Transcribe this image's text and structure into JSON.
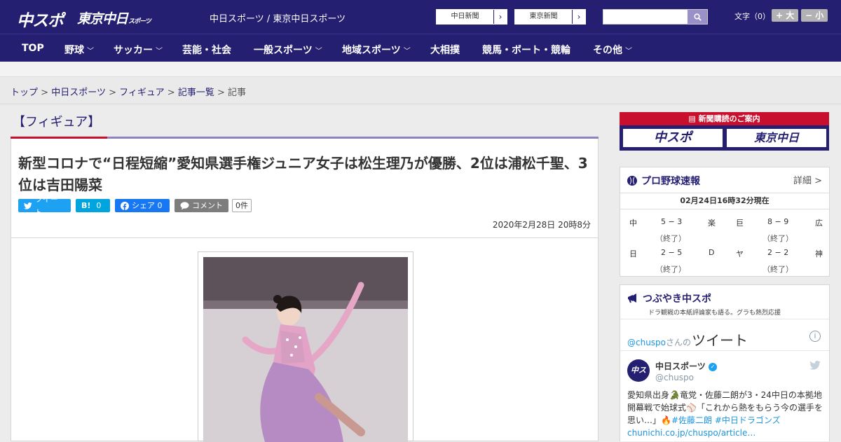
{
  "header": {
    "logo_main": "中スポ",
    "logo_tokyo": "東京中日",
    "logo_tokyo_small": "スポーツ",
    "site_links": "中日スポーツ / 東京中日スポーツ",
    "btn_chunichi": "中日新聞",
    "btn_tokyo": "東京新聞",
    "search_placeholder": "",
    "font_size_label": "文字（0）",
    "font_plus": "+ 大",
    "font_minus": "− 小"
  },
  "nav": {
    "items": [
      {
        "label": "TOP",
        "has_menu": false
      },
      {
        "label": "野球",
        "has_menu": true
      },
      {
        "label": "サッカー",
        "has_menu": true
      },
      {
        "label": "芸能・社会",
        "has_menu": false
      },
      {
        "label": "一般スポーツ",
        "has_menu": true
      },
      {
        "label": "地域スポーツ",
        "has_menu": true
      },
      {
        "label": "大相撲",
        "has_menu": false
      },
      {
        "label": "競馬・ボート・競輪",
        "has_menu": false
      },
      {
        "label": "その他",
        "has_menu": true
      }
    ]
  },
  "breadcrumb": {
    "top": "トップ",
    "site": "中日スポーツ",
    "category": "フィギュア",
    "list": "記事一覧",
    "current": "記事",
    "separator": ">"
  },
  "category_title": "【フィギュア】",
  "article": {
    "headline": "新型コロナで“日程短縮”愛知県選手権ジュニア女子は松生理乃が優勝、2位は浦松千聖、3位は吉田陽菜",
    "share": {
      "tweet": "ツイート",
      "hatena_icon": "B!",
      "hatena_count": "0",
      "facebook": "シェア 0",
      "comment": "コメント",
      "comment_count": "0件"
    },
    "date": "2020年2月28日 20時8分"
  },
  "sidebar": {
    "subscribe_header": "新聞購読のご案内",
    "subscribe_chuspo": "中スポ",
    "subscribe_tokyo": "東京中日",
    "baseball": {
      "title": "プロ野球速報",
      "detail": "詳細 >",
      "timestamp": "02月24日16時32分現在",
      "games": [
        {
          "home": "中",
          "score": "5 − 3",
          "away": "楽",
          "status": "（終了）"
        },
        {
          "home": "巨",
          "score": "8 − 9",
          "away": "広",
          "status": "（終了）"
        },
        {
          "home": "日",
          "score": "2 − 5",
          "away": "D",
          "status": "（終了）"
        },
        {
          "home": "ヤ",
          "score": "2 − 2",
          "away": "神",
          "status": "（終了）"
        }
      ]
    },
    "twitter": {
      "title": "つぶやき中スポ",
      "subtitle": "ドラ観戦の本紙評論家も語る。グラも熱烈応援",
      "user_prefix": "@chuspo",
      "user_suffix": "さんの",
      "tweets_label": "ツイート",
      "name": "中日スポーツ",
      "handle": "@chuspo",
      "text_1": "愛知県出身🐊竜党・佐藤二朗が3・24中日の本拠地開幕戦で始球式⚾「これから熱をもらう今の選手を思い…」🔥",
      "hashtags": "#佐藤二朗 #中日ドラゴンズ",
      "link": "chunichi.co.jp/chuspo/article…",
      "avatar_text": "中スポ"
    }
  },
  "colors": {
    "brand_navy": "#241f70",
    "accent_red": "#c8102e",
    "twitter_blue": "#1da1f2",
    "hatena_blue": "#00a4de",
    "facebook_blue": "#1877f2"
  }
}
